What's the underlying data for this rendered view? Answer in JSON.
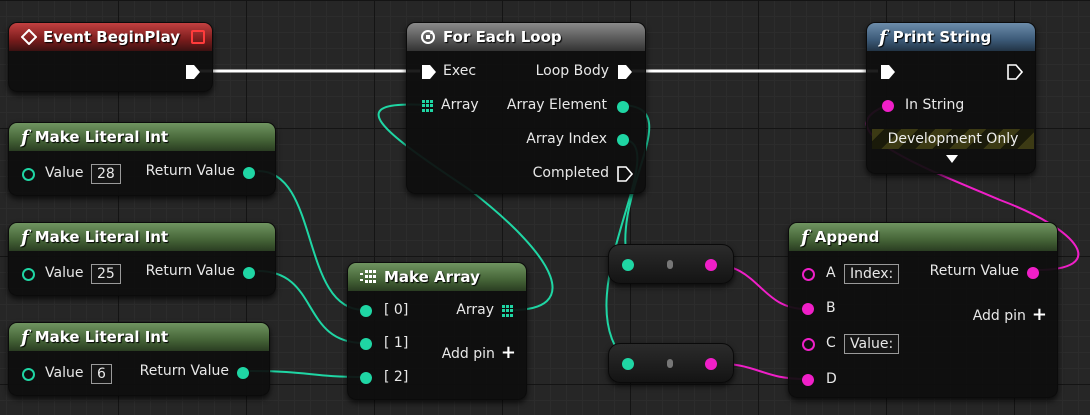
{
  "colors": {
    "exec": "#ffffff",
    "int_pin": "#1fd6a4",
    "string_pin": "#f01fc8",
    "event_header": "#8c2222",
    "macro_header": "#5e5e5e",
    "call_header": "#3c5a78",
    "pure_header": "#456437",
    "graph_background": "#262626"
  },
  "event_begin_play": {
    "title": "Event BeginPlay"
  },
  "for_each_loop": {
    "title": "For Each Loop",
    "exec_in": "Exec",
    "array_in": "Array",
    "loop_body": "Loop Body",
    "array_element": "Array Element",
    "array_index": "Array Index",
    "completed": "Completed"
  },
  "print_string": {
    "title": "Print String",
    "in_string": "In String",
    "dev_only": "Development Only"
  },
  "make_literal_1": {
    "title": "Make Literal Int",
    "value_label": "Value",
    "value": "28",
    "return_value": "Return Value"
  },
  "make_literal_2": {
    "title": "Make Literal Int",
    "value_label": "Value",
    "value": "25",
    "return_value": "Return Value"
  },
  "make_literal_3": {
    "title": "Make Literal Int",
    "value_label": "Value",
    "value": "6",
    "return_value": "Return Value"
  },
  "make_array": {
    "title": "Make Array",
    "pin0": "[ 0]",
    "pin1": "[ 1]",
    "pin2": "[ 2]",
    "array_out": "Array",
    "add_pin": "Add pin"
  },
  "append": {
    "title": "Append",
    "a": "A",
    "a_value": "Index:",
    "b": "B",
    "c": "C",
    "c_value": "Value:",
    "d": "D",
    "return_value": "Return Value",
    "add_pin": "Add pin"
  },
  "icons": {
    "event": "event-diamond-icon",
    "loop": "loop-macro-icon",
    "function": "function-f-icon",
    "make_array": "make-array-icon",
    "array_grid": "array-grid-icon",
    "add": "plus-icon",
    "expand": "chevron-down-icon",
    "delegate": "delegate-red-square-icon"
  }
}
